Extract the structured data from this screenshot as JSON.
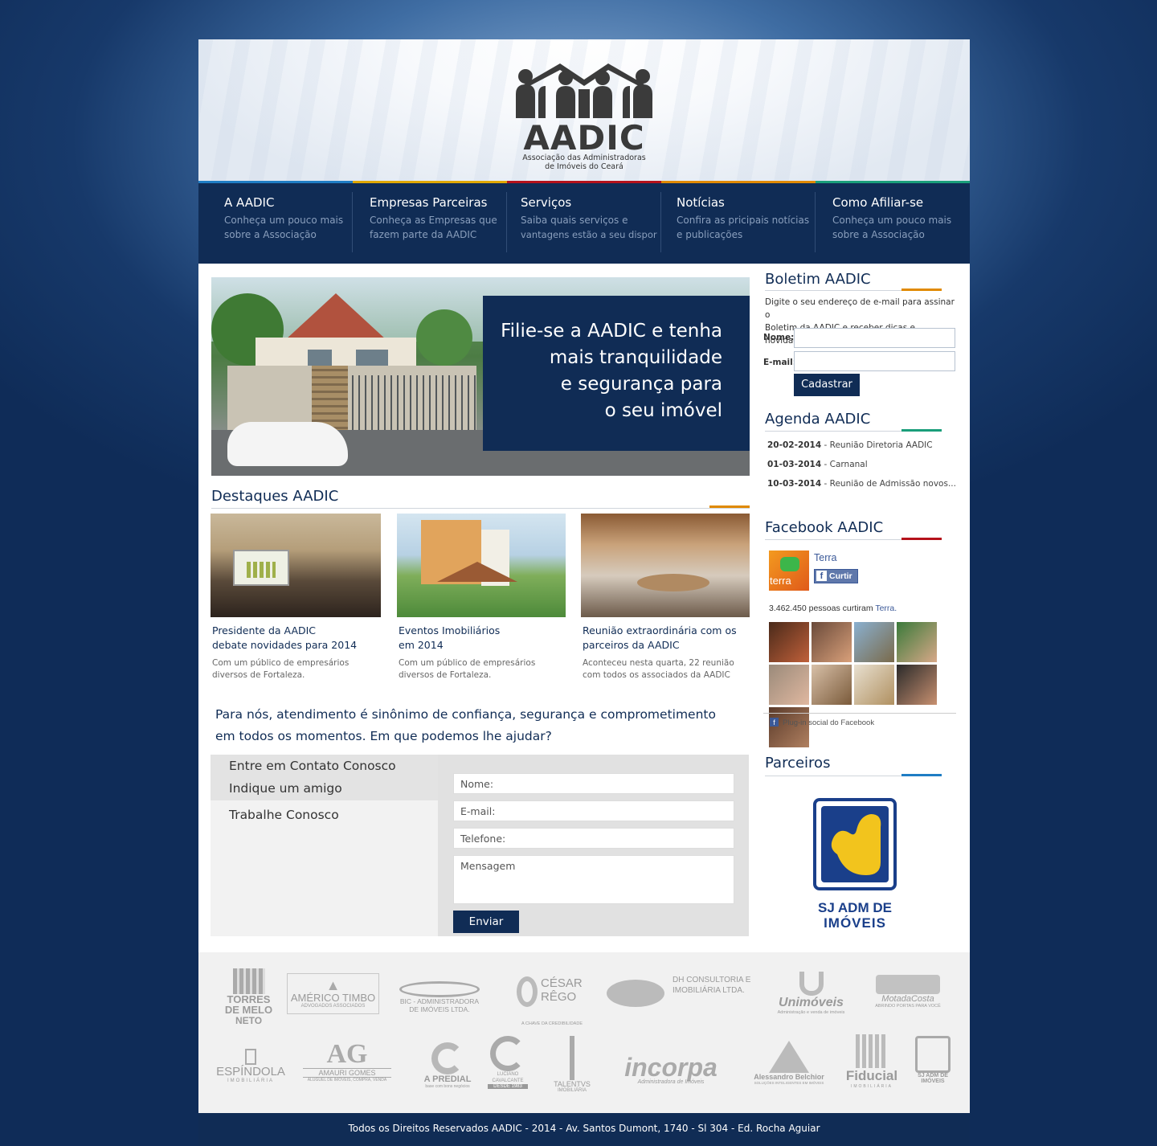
{
  "header": {
    "logo_text": "AADIC",
    "logo_subtitle_line1": "Associação das Administradoras",
    "logo_subtitle_line2": "de Imóveis do Ceará"
  },
  "nav": [
    {
      "title": "A AADIC",
      "desc1": "Conheça um pouco mais",
      "desc2": "sobre a Associação",
      "color": "#1f7dc4"
    },
    {
      "title": "Empresas Parceiras",
      "desc1": "Conheça as Empresas que",
      "desc2": "fazem parte da AADIC",
      "color": "#e0a800"
    },
    {
      "title": "Serviços",
      "desc1": "Saiba quais serviços e",
      "desc2": "vantagens estão a seu dispor",
      "color": "#b5121b"
    },
    {
      "title": "Notícias",
      "desc1": "Confira as pricipais notícias",
      "desc2": "e publicações",
      "color": "#e08a00"
    },
    {
      "title": "Como Afiliar-se",
      "desc1": "Conheça um pouco mais",
      "desc2": "sobre a Associação",
      "color": "#1a9e7a"
    }
  ],
  "banner": {
    "line1": "Filie-se a AADIC e tenha",
    "line2": "mais tranquilidade",
    "line3": "e segurança para",
    "line4": "o seu imóvel"
  },
  "highlights": {
    "title": "Destaques AADIC",
    "cards": [
      {
        "title1": "Presidente da AADIC",
        "title2": "debate novidades para 2014",
        "desc1": "Com um público de empresários",
        "desc2": "diversos de Fortaleza."
      },
      {
        "title1": "Eventos Imobiliários",
        "title2": "em 2014",
        "desc1": "Com um público de empresários",
        "desc2": "diversos de Fortaleza."
      },
      {
        "title1": "Reunião extraordinária com os",
        "title2": "parceiros da AADIC",
        "desc1": "Aconteceu nesta quarta, 22 reunião",
        "desc2": "com todos os associados da AADIC"
      }
    ]
  },
  "tagline": {
    "line1": "Para nós, atendimento é sinônimo de confiança, segurança e comprometimento",
    "line2": "em todos os momentos. Em que podemos lhe ajudar?"
  },
  "contact": {
    "tabs": [
      "Entre em Contato Conosco",
      "Indique um amigo",
      "Trabalhe Conosco"
    ],
    "name_placeholder": "Nome:",
    "email_placeholder": "E-mail:",
    "phone_placeholder": "Telefone:",
    "message_placeholder": "Mensagem",
    "send_label": "Enviar"
  },
  "newsletter": {
    "title": "Boletim AADIC",
    "text1": "Digite o seu endereço de e-mail para assinar o",
    "text2": "Boletim da AADIC e receber dicas e novidades.",
    "name_label": "Nome:",
    "email_label": "E-mail:",
    "button": "Cadastrar"
  },
  "agenda": {
    "title": "Agenda AADIC",
    "items": [
      {
        "date": "20-02-2014",
        "text": " - Reunião Diretoria AADIC"
      },
      {
        "date": "01-03-2014",
        "text": " - Carnanal"
      },
      {
        "date": "10-03-2014",
        "text": " - Reunião de Admissão novos..."
      }
    ]
  },
  "facebook": {
    "title": "Facebook AADIC",
    "page_name": "Terra",
    "page_logo_text": "terra",
    "like_button": "Curtir",
    "likes_text": "3.462.450 pessoas curtiram ",
    "likes_link": "Terra.",
    "plugin_text": "Plug-in social do Facebook"
  },
  "partners": {
    "title": "Parceiros",
    "featured_line1": "SJ ADM DE",
    "featured_line2": "IMÓVEIS",
    "logos": [
      {
        "main": "TORRES DE MELO",
        "sub": "NETO"
      },
      {
        "main": "AMÉRICO TIMBO",
        "sub": "ADVOGADOS ASSOCIADOS"
      },
      {
        "main": "BIC - ADMINISTRADORA",
        "sub": "DE IMÓVEIS LTDA."
      },
      {
        "main": "CÉSAR RÊGO",
        "sub": "A CHAVE DA CREDIBILIDADE"
      },
      {
        "main": "DH CONSULTORIA E",
        "sub": "IMOBILIÁRIA LTDA."
      },
      {
        "main": "Unimóveis",
        "sub": "Administração e venda de imóveis"
      },
      {
        "main": "MotadaCosta",
        "sub": "ABRINDO PORTAS PARA VOCÊ"
      },
      {
        "main": "ESPÍNDOLA",
        "sub": "IMOBILIÁRIA"
      },
      {
        "main": "AMAURI GOMES",
        "sub": "ALUGUEL DE IMÓVEIS, COMPRA, VENDA"
      },
      {
        "main": "A PREDIAL",
        "sub": "base com bons negócios"
      },
      {
        "main": "LUCIANO CAVALCANTE",
        "sub": "DESDE 1983"
      },
      {
        "main": "TALENTVS",
        "sub": "IMOBILIÁRIA"
      },
      {
        "main": "incorpa",
        "sub": "Administradora de Imóveis"
      },
      {
        "main": "Alessandro Belchior",
        "sub": "SOLUÇÕES INTELIGENTES EM IMÓVEIS"
      },
      {
        "main": "Fiducial",
        "sub": "IMOBILIÁRIA"
      },
      {
        "main": "SJ ADM DE",
        "sub": "IMÓVEIS"
      }
    ]
  },
  "footer": {
    "text": "Todos os Direitos Reservados AADIC - 2014 - Av. Santos Dumont, 1740 - Sl 304 -  Ed. Rocha Aguiar"
  },
  "colors": {
    "navy": "#102c55",
    "accent_orange": "#e08a00",
    "accent_teal": "#1a9e7a",
    "accent_red": "#b5121b",
    "accent_blue": "#1f7dc4"
  }
}
